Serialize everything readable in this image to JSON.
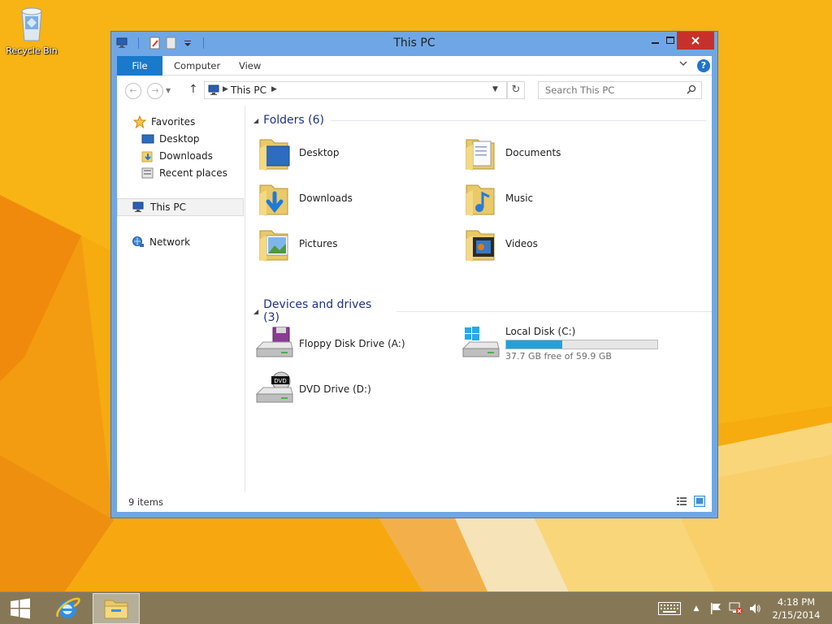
{
  "desktop": {
    "recycle_bin_label": "Recycle Bin"
  },
  "window": {
    "title": "This PC",
    "ribbon_tabs": [
      "File",
      "Computer",
      "View"
    ],
    "address": {
      "crumb": "This PC"
    },
    "search": {
      "placeholder": "Search This PC"
    },
    "nav_pane": {
      "favorites": "Favorites",
      "items": [
        "Desktop",
        "Downloads",
        "Recent places"
      ],
      "this_pc": "This PC",
      "network": "Network"
    },
    "groups": {
      "folders_title": "Folders (6)",
      "folders": [
        "Desktop",
        "Documents",
        "Downloads",
        "Music",
        "Pictures",
        "Videos"
      ],
      "devices_title": "Devices and drives (3)",
      "devices": {
        "floppy": "Floppy Disk Drive (A:)",
        "local_disk": "Local Disk (C:)",
        "local_disk_free": "37.7 GB free of 59.9 GB",
        "local_disk_used_fraction": 0.37,
        "dvd": "DVD Drive (D:)"
      }
    },
    "status": {
      "count": "9 items"
    }
  },
  "taskbar": {
    "time": "4:18 PM",
    "date": "2/15/2014"
  },
  "colors": {
    "accent": "#1979ca",
    "close": "#c7312b",
    "drive_fill": "#26a0da",
    "wallpaper": "#f5a90d"
  }
}
